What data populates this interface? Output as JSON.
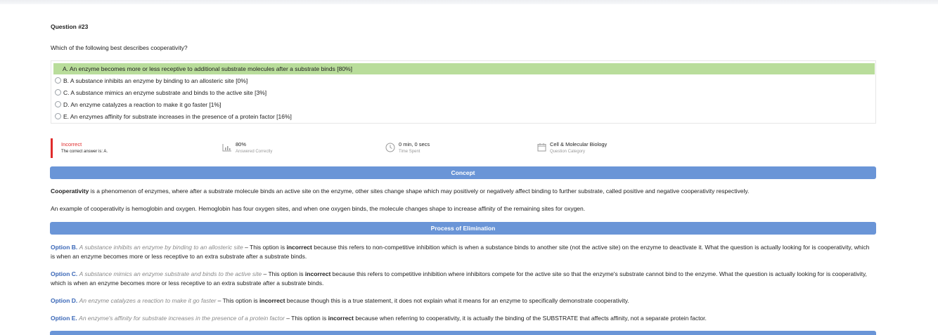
{
  "question": {
    "number": "Question #23",
    "text": "Which of the following best describes cooperativity?"
  },
  "answers": [
    {
      "text": "A. An enzyme becomes more or less receptive to additional substrate molecules after a substrate binds [80%]",
      "correct": true
    },
    {
      "text": "B. A substance inhibits an enzyme by binding to an allosteric site [0%]",
      "correct": false
    },
    {
      "text": "C. A substance mimics an enzyme substrate and binds to the active site [3%]",
      "correct": false
    },
    {
      "text": "D. An enzyme catalyzes a reaction to make it go faster [1%]",
      "correct": false
    },
    {
      "text": "E. An enzymes affinity for substrate increases in the presence of a protein factor [16%]",
      "correct": false
    }
  ],
  "stats": {
    "result": {
      "title": "Incorrect",
      "subtitle": "The correct answer is: A."
    },
    "percent": {
      "title": "80%",
      "subtitle": "Answered Correctly",
      "icon": "bar-chart-icon"
    },
    "time": {
      "title": "0 min, 0 secs",
      "subtitle": "Time Spent",
      "icon": "clock-icon"
    },
    "category": {
      "title": "Cell & Molecular Biology",
      "subtitle": "Question Category",
      "icon": "calendar-icon"
    }
  },
  "sections": {
    "concept": "Concept",
    "elimination": "Process of Elimination"
  },
  "concept": {
    "p1_bold": "Cooperativity",
    "p1_rest": " is a phenomenon of enzymes, where after a substrate molecule binds an active site on the enzyme, other sites change shape which may positively or negatively affect binding to further substrate, called positive and negative cooperativity respectively.",
    "p2": "An example of cooperativity is hemoglobin and oxygen. Hemoglobin has four oxygen sites, and when one oxygen binds, the molecule changes shape to increase affinity of the remaining sites for oxygen."
  },
  "elimination": [
    {
      "label": "Option B.",
      "quote": "A substance inhibits an enzyme by binding to an allosteric site",
      "pre": " – This option is ",
      "verdict": "incorrect",
      "post": " because this refers to non-competitive inhibition which is when a substance binds to another site (not the active site) on the enzyme to deactivate it. What the question is actually looking for is cooperativity, which is when an enzyme becomes more or less receptive to an extra substrate after a substrate binds."
    },
    {
      "label": "Option C.",
      "quote": "A substance mimics an enzyme substrate and binds to the active site",
      "pre": " – This option is ",
      "verdict": "incorrect",
      "post": " because this refers to competitive inhibition where inhibitors compete for the active site so that the enzyme's substrate cannot bind to the enzyme. What the question is actually looking for is cooperativity, which is when an enzyme becomes more or less receptive to an extra substrate after a substrate binds."
    },
    {
      "label": "Option D.",
      "quote": "An enzyme catalyzes a reaction to make it go faster",
      "pre": " – This option is ",
      "verdict": "incorrect",
      "post": " because though this is a true statement, it does not explain what it means for an enzyme to specifically demonstrate cooperativity."
    },
    {
      "label": "Option E.",
      "quote": "An enzyme's affinity for substrate increases in the presence of a protein factor ",
      "pre": " – This option is ",
      "verdict": "incorrect",
      "post": " because when referring to cooperativity, it is actually the binding of the SUBSTRATE that affects affinity, not a separate protein factor."
    }
  ]
}
